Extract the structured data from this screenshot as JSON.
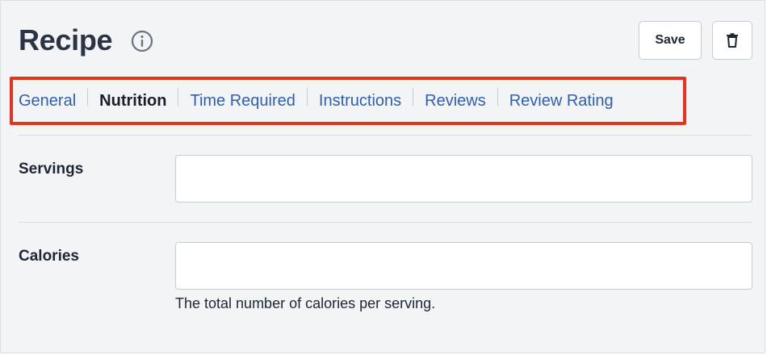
{
  "header": {
    "title": "Recipe",
    "info_icon": "info-circle-icon",
    "save_label": "Save",
    "delete_icon": "trash-icon"
  },
  "tabs": [
    {
      "label": "General",
      "active": false
    },
    {
      "label": "Nutrition",
      "active": true
    },
    {
      "label": "Time Required",
      "active": false
    },
    {
      "label": "Instructions",
      "active": false
    },
    {
      "label": "Reviews",
      "active": false
    },
    {
      "label": "Review Rating",
      "active": false
    }
  ],
  "fields": {
    "servings": {
      "label": "Servings",
      "value": ""
    },
    "calories": {
      "label": "Calories",
      "value": "",
      "help": "The total number of calories per serving."
    }
  },
  "colors": {
    "tab_link": "#2f5eb3",
    "tab_active": "#1b1f29",
    "highlight_box": "#e8321e",
    "title": "#2b3445",
    "background": "#f3f4f6"
  }
}
